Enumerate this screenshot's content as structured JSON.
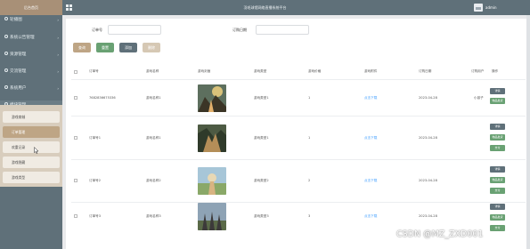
{
  "header": {
    "brand": "后台首页",
    "system_title": "羽毛球馆网络直播系统平台",
    "user": "admin"
  },
  "sidebar": {
    "items": [
      {
        "label": "轮播图",
        "icon": "image-icon"
      },
      {
        "label": "系统公告管理",
        "icon": "bell-icon"
      },
      {
        "label": "资源管理",
        "icon": "pin-icon"
      },
      {
        "label": "交流管理",
        "icon": "chat-icon"
      },
      {
        "label": "系统用户",
        "icon": "user-icon"
      },
      {
        "label": "模块管理",
        "icon": "grid-icon"
      }
    ],
    "submenu": [
      "游戏商城",
      "订单管理",
      "欢重记录",
      "游戏隐藏",
      "游戏类型"
    ]
  },
  "search": {
    "order_no_label": "订单号",
    "order_date_label": "订购日期"
  },
  "buttons": {
    "query": "查询",
    "reset": "重置",
    "add": "添加",
    "delete": "删除"
  },
  "table": {
    "columns": [
      "订单号",
      "游戏名称",
      "游戏封面",
      "游戏类型",
      "游戏价格",
      "游戏附件",
      "订购日期",
      "订购用户",
      "操作"
    ],
    "rows": [
      {
        "order_no": "7682836675336",
        "name": "游戏名称1",
        "type": "游戏类型1",
        "price": "1",
        "attachment": "点击下载",
        "date": "2023-04-28",
        "user": "小孩子",
        "actions": [
          "详情",
          "物品发货"
        ]
      },
      {
        "order_no": "订单号1",
        "name": "游戏名称1",
        "type": "游戏类型1",
        "price": "1",
        "attachment": "点击下载",
        "date": "2023-04-28",
        "user": "",
        "actions": [
          "详情",
          "物品发货",
          "支付"
        ]
      },
      {
        "order_no": "订单号2",
        "name": "游戏名称2",
        "type": "游戏类型2",
        "price": "2",
        "attachment": "点击下载",
        "date": "2023-04-28",
        "user": "",
        "actions": [
          "详情",
          "物品发货",
          "支付"
        ]
      },
      {
        "order_no": "订单号3",
        "name": "游戏名称3",
        "type": "游戏类型3",
        "price": "3",
        "attachment": "点击下载",
        "date": "2023-04-28",
        "user": "",
        "actions": [
          "详情",
          "物品发货",
          "支付"
        ]
      }
    ]
  },
  "watermark": "CSDN @MZ_ZXD001",
  "colors": {
    "sidebar_bg": "#5f7079",
    "brand_bg": "#a89077",
    "submenu_bg": "#d8cdbd",
    "active_submenu": "#bea585",
    "btn_query": "#bea585",
    "btn_reset": "#69a173",
    "btn_add": "#5f7079",
    "btn_delete": "#d6c8b4",
    "link": "#409eff"
  }
}
